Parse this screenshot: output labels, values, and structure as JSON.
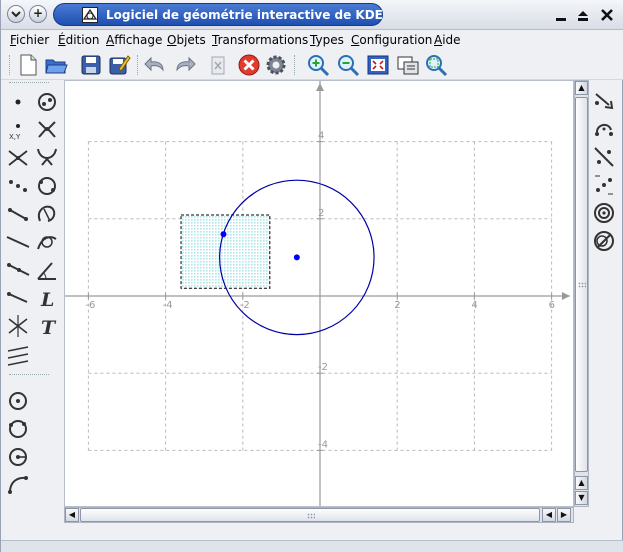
{
  "window": {
    "title": "Logiciel de géométrie interactive de KDE",
    "sticky_label": "+",
    "controls": {
      "minimize": "▁",
      "maximize": "⏶",
      "close": "✕"
    }
  },
  "menu": {
    "items": [
      {
        "id": "fichier",
        "label": "Fichier"
      },
      {
        "id": "edition",
        "label": "Édition"
      },
      {
        "id": "affichage",
        "label": "Affichage"
      },
      {
        "id": "objets",
        "label": "Objets"
      },
      {
        "id": "transformations",
        "label": "Transformations"
      },
      {
        "id": "types",
        "label": "Types"
      },
      {
        "id": "configuration",
        "label": "Configuration"
      },
      {
        "id": "aide",
        "label": "Aide"
      }
    ]
  },
  "toolbar": {
    "icons": [
      "new-document-icon",
      "open-folder-icon",
      "save-icon",
      "save-as-icon",
      "undo-icon",
      "redo-icon",
      "delete-icon",
      "cancel-construction-icon",
      "settings-gear-icon",
      "zoom-in-icon",
      "zoom-out-icon",
      "fit-to-screen-icon",
      "export-icon",
      "zoom-area-icon"
    ]
  },
  "canvas": {
    "x_ticks": [
      "-6",
      "-4",
      "-2",
      "2",
      "4",
      "6"
    ],
    "y_ticks": [
      "4",
      "2",
      "-2",
      "-4"
    ],
    "colors": {
      "circle": "#0000a8",
      "point": "#0000ff",
      "polygon_fill": "#aee6ea",
      "grid": "#b9b9b9",
      "axis": "#9a9a9a"
    },
    "circle": {
      "center": [
        -0.6,
        1.0
      ],
      "radius": 2.0
    },
    "points": [
      {
        "x": -2.5,
        "y": 1.6
      },
      {
        "x": -0.6,
        "y": 1.0
      }
    ],
    "polygon": {
      "x_min": -3.6,
      "x_max": -1.3,
      "y_min": 0.2,
      "y_max": 2.1
    }
  },
  "palette_left": {
    "icons": [
      "point-icon",
      "special-point-icon",
      "coordinate-point-icon",
      "midpoint-icon",
      "intersection-icon",
      "circle-through-points-icon",
      "constrained-point-icon",
      "locus-icon",
      "segment-icon",
      "arc-icon",
      "line-icon",
      "vector-icon",
      "ray-icon",
      "angle-icon",
      "perpendicular-icon",
      "label-icon",
      "bisector-icon",
      "text-icon",
      "parallel-icon",
      "circle-center-icon",
      "circle-three-points-icon",
      "circle-center-point-icon",
      "arc-three-points-icon"
    ],
    "label_glyph": "L",
    "text_glyph": "T"
  },
  "palette_right": {
    "icons": [
      "translation-icon",
      "rotation-icon",
      "reflection-line-icon",
      "point-reflection-icon",
      "homothety-icon",
      "inversion-icon"
    ]
  },
  "scroll": {
    "up_arrow": "▲",
    "down_arrow": "▼",
    "left_arrow": "◀",
    "right_arrow": "▶"
  }
}
